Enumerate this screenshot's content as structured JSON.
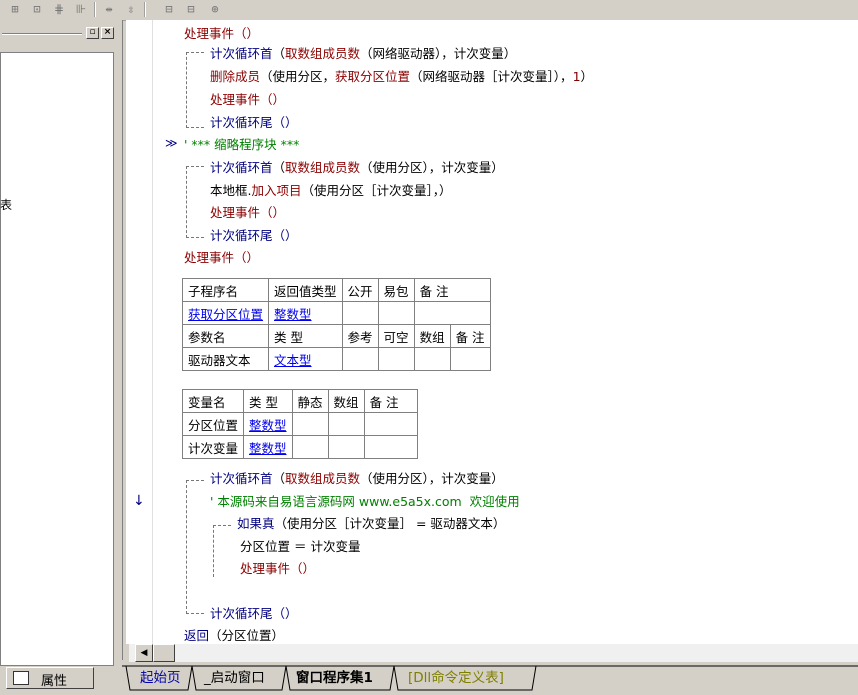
{
  "toolbar": {
    "icons": [
      "split-grid-icon",
      "table-icon",
      "column-icon",
      "frame-icon",
      "h-align-icon",
      "v-align-icon",
      "h-size-icon",
      "v-size-icon",
      "center-icon"
    ]
  },
  "left_panel": {
    "partial_text": "表",
    "properties_button": "属性"
  },
  "code": {
    "l1": "处理事件（）",
    "l2a": "计次循环首",
    "l2b": "（",
    "l2c": "取数组成员数",
    "l2d": "（网络驱动器），计次变量）",
    "l3a": "删除成员",
    "l3b": "（使用分区，",
    "l3c": "获取分区位置",
    "l3d": "（网络驱动器［计次变量］），",
    "l3e": "1",
    "l3f": "）",
    "l4": "处理事件（）",
    "l5": "计次循环尾（）",
    "marker": "≫",
    "l6": "' *** 缩略程序块 ***",
    "l7a": "计次循环首",
    "l7b": "（",
    "l7c": "取数组成员数",
    "l7d": "（使用分区），计次变量）",
    "l8a": "本地框.",
    "l8b": "加入项目",
    "l8c": "（使用分区［计次变量］，）",
    "l9": "处理事件（）",
    "l10": "计次循环尾（）",
    "l11": "处理事件（）",
    "l12a": "计次循环首",
    "l12b": "（",
    "l12c": "取数组成员数",
    "l12d": "（使用分区），计次变量）",
    "l13": "' 本源码来自易语言源码网 www.e5a5x.com  欢迎使用",
    "l14a": "如果真",
    "l14b": "（使用分区［计次变量］ = 驱动器文本）",
    "l15": "分区位置 ＝ 计次变量",
    "l16": "处理事件（）",
    "l17": "计次循环尾（）",
    "l18a": "返回",
    "l18b": "（分区位置）",
    "down_arrow": "↓"
  },
  "sub_table": {
    "h": [
      "子程序名",
      "返回值类型",
      "公开",
      "易包",
      "备 注"
    ],
    "r1": [
      "获取分区位置",
      "整数型",
      "",
      "",
      ""
    ],
    "ph": [
      "参数名",
      "类 型",
      "参考",
      "可空",
      "数组",
      "备 注"
    ],
    "pr": [
      "驱动器文本",
      "文本型",
      "",
      "",
      "",
      ""
    ]
  },
  "var_table": {
    "h": [
      "变量名",
      "类 型",
      "静态",
      "数组",
      "备 注"
    ],
    "rows": [
      [
        "分区位置",
        "整数型",
        "",
        "",
        ""
      ],
      [
        "计次变量",
        "整数型",
        "",
        "",
        ""
      ]
    ]
  },
  "tabs": [
    "起始页",
    "_启动窗口",
    "窗口程序集1",
    "[Dll命令定义表]"
  ],
  "colors": {
    "keyword": "#000080",
    "command": "#8b0000",
    "comment": "#008000",
    "link": "#0000ee"
  }
}
